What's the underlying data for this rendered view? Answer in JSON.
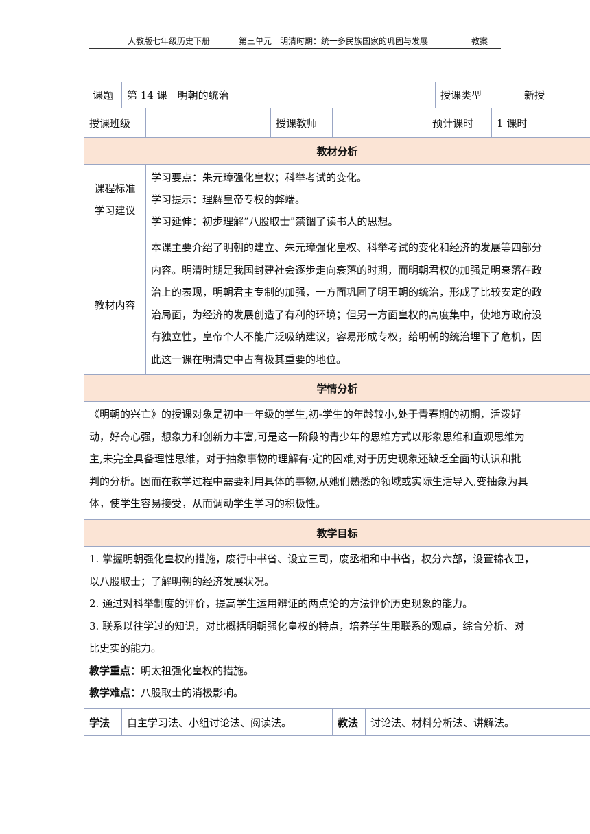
{
  "header": {
    "book": "人教版七年级历史下册",
    "unit": "第三单元　明清时期：统一多民族国家的巩固与发展",
    "type": "教案"
  },
  "lesson": {
    "topic_label": "课题",
    "topic_value": "第 14 课　明朝的统治",
    "type_label": "授课类型",
    "type_value": "新授",
    "class_label": "授课班级",
    "class_value": "",
    "teacher_label": "授课教师",
    "teacher_value": "",
    "hours_label": "预计课时",
    "hours_value": "1 课时"
  },
  "material_analysis": {
    "title": "教材分析",
    "standard_label": [
      "课程标准",
      "学习建议"
    ],
    "standard_lines": [
      "学习要点：朱元璋强化皇权；科举考试的变化。",
      "学习提示：理解皇帝专权的弊端。",
      "学习延伸：初步理解“八股取士”禁锢了读书人的思想。"
    ],
    "content_label": "教材内容",
    "content_lines": [
      "本课主要介绍了明朝的建立、朱元璋强化皇权、科举考试的变化和经济的发展等四部分",
      "内容。明清时期是我国封建社会逐步走向衰落的时期，而明朝君权的加强是明衰落在政",
      "治上的表现，明朝君主专制的加强，一方面巩固了明王朝的统治，形成了比较安定的政",
      "治局面，为经济的发展创造了有利的环境；但另一方面皇权的高度集中，使地方政府没",
      "有独立性，皇帝个人不能广泛吸纳建议，容易形成专权，给明朝的统治埋下了危机，因",
      "此这一课在明清史中占有极其重要的地位。"
    ]
  },
  "student_analysis": {
    "title": "学情分析",
    "lines": [
      "《明朝的兴亡》的授课对象是初中一年级的学生,初-学生的年龄较小,处于青春期的初期，活泼好",
      "动，好奇心强，想象力和创新力丰富,可是这一阶段的青少年的思维方式以形象思维和直观思维为",
      "主,未完全具备理性思维，对于抽象事物的理解有-定的困难,对于历史现象还缺乏全面的认识和批",
      "判的分析。因而在教学过程中需要利用具体的事物,从她们熟悉的领域或实际生活导入,变抽象为具",
      "体，使学生容易接受，从而调动学生学习的积极性。"
    ]
  },
  "teaching_goals": {
    "title": "教学目标",
    "lines": [
      "1. 掌握明朝强化皇权的措施，废行中书省、设立三司，废丞相和中书省，权分六部，设置锦衣卫，",
      "以八股取士；了解明朝的经济发展状况。",
      "2. 通过对科举制度的评价，提高学生运用辩证的两点论的方法评价历史现象的能力。",
      "3. 联系以往学过的知识，对比概括明朝强化皇权的特点，培养学生用联系的观点，综合分析、对",
      "比史实的能力。"
    ],
    "key_label": "教学重点：",
    "key_value": "明太祖强化皇权的措施。",
    "difficulty_label": "教学难点：",
    "difficulty_value": "八股取士的消极影响。"
  },
  "methods": {
    "study_label": "学法",
    "study_value": "自主学习法、小组讨论法、阅读法。",
    "teach_label": "教法",
    "teach_value": "讨论法、材料分析法、讲解法。"
  }
}
